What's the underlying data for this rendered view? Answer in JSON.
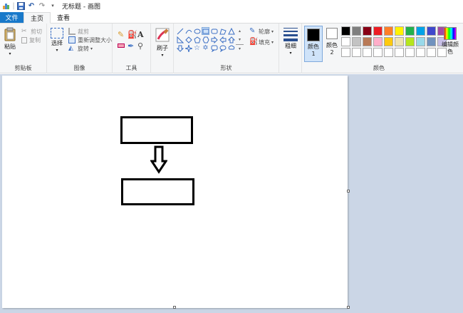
{
  "window": {
    "title": "无标题 - 画图"
  },
  "tabs": {
    "file": "文件",
    "home": "主页",
    "view": "查看"
  },
  "clipboard": {
    "paste": "粘贴",
    "cut": "剪切",
    "copy": "复制",
    "group": "剪贴板"
  },
  "image": {
    "select": "选择",
    "crop": "裁剪",
    "resize": "重新调整大小",
    "rotate": "旋转",
    "group": "图像"
  },
  "tools": {
    "group": "工具"
  },
  "brushes": {
    "label": "刷子"
  },
  "shapes": {
    "outline": "轮廓",
    "fill": "填充",
    "group": "形状"
  },
  "size": {
    "label": "粗细"
  },
  "colors": {
    "color1": "颜色 1",
    "color2": "颜色 2",
    "edit": "编辑颜色",
    "group": "颜色",
    "palette_row1": [
      "#000000",
      "#7f7f7f",
      "#880015",
      "#ed1c24",
      "#ff7f27",
      "#fff200",
      "#22b14c",
      "#00a2e8",
      "#3f48cc",
      "#a349a4"
    ],
    "palette_row2": [
      "#ffffff",
      "#c3c3c3",
      "#b97a57",
      "#ffaec9",
      "#ffc90e",
      "#efe4b0",
      "#b5e61d",
      "#99d9ea",
      "#7092be",
      "#c8bfe7"
    ],
    "palette_row3": [
      "#ffffff",
      "#ffffff",
      "#ffffff",
      "#ffffff",
      "#ffffff",
      "#ffffff",
      "#ffffff",
      "#ffffff",
      "#ffffff",
      "#ffffff"
    ]
  }
}
